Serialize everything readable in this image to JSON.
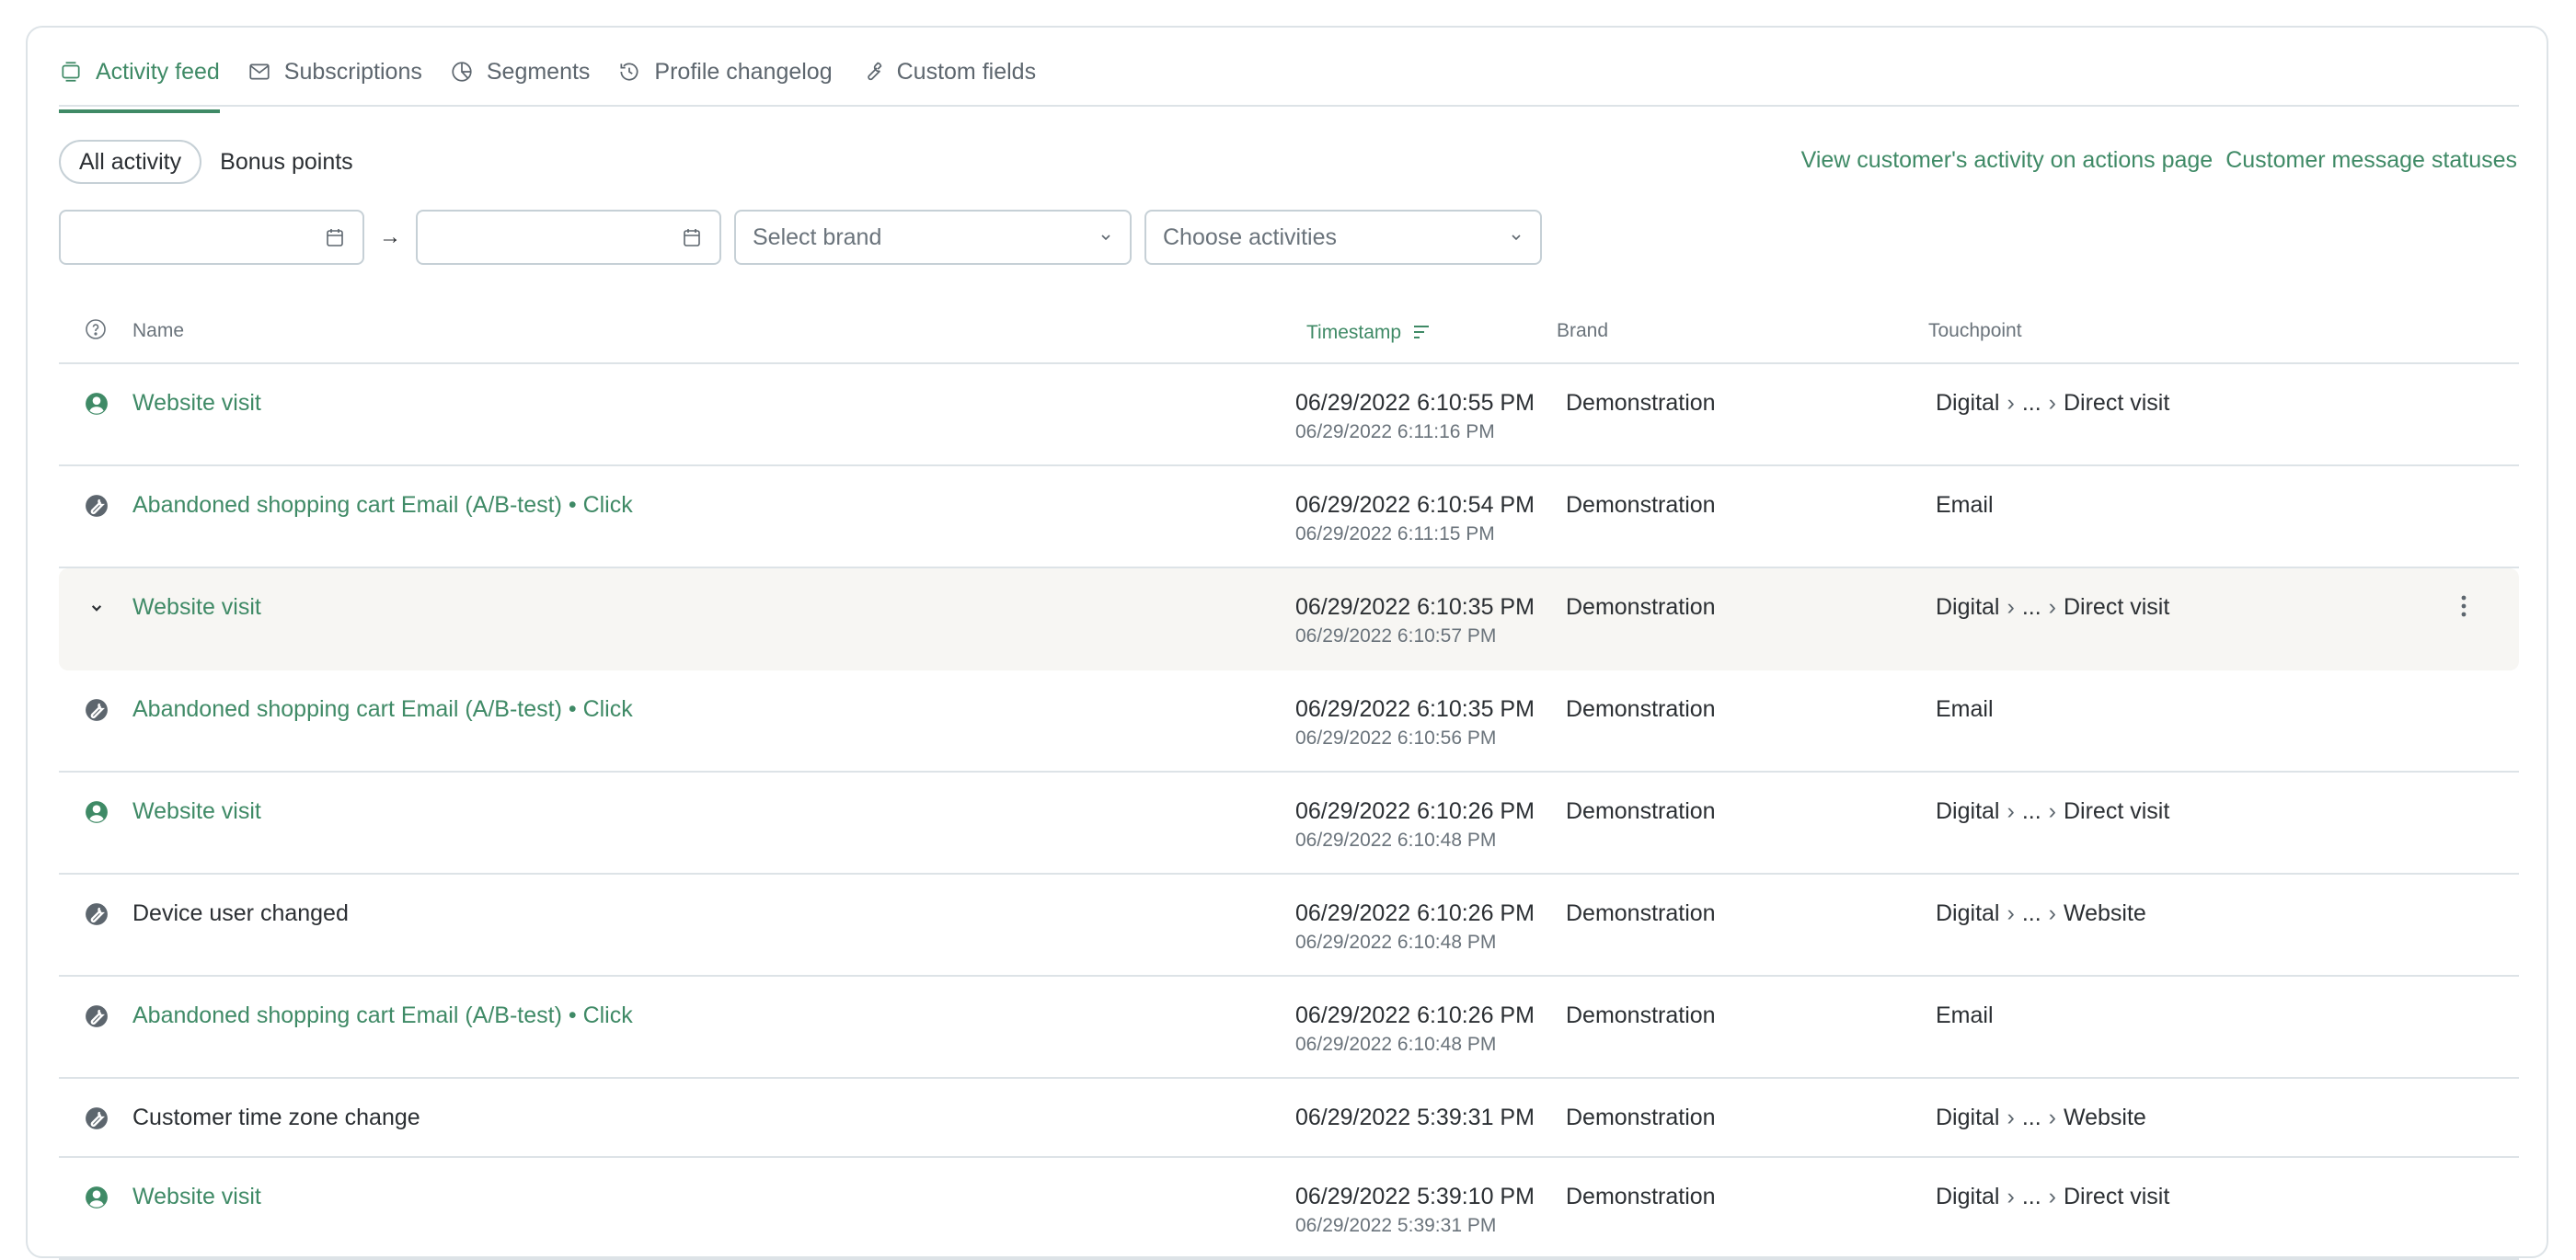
{
  "tabs": [
    {
      "label": "Activity feed",
      "icon": "activity-feed-icon",
      "active": true
    },
    {
      "label": "Subscriptions",
      "icon": "envelope-icon",
      "active": false
    },
    {
      "label": "Segments",
      "icon": "pie-chart-icon",
      "active": false
    },
    {
      "label": "Profile changelog",
      "icon": "history-icon",
      "active": false
    },
    {
      "label": "Custom fields",
      "icon": "wrench-icon",
      "active": false
    }
  ],
  "pills": [
    {
      "label": "All activity",
      "active": true
    },
    {
      "label": "Bonus points",
      "active": false
    }
  ],
  "links": {
    "actions_page": "View customer's activity on actions page",
    "message_statuses": "Customer message statuses"
  },
  "filters": {
    "date_from": "",
    "date_to": "",
    "arrow": "→",
    "brand_placeholder": "Select brand",
    "activities_placeholder": "Choose activities"
  },
  "table": {
    "headers": {
      "name": "Name",
      "timestamp": "Timestamp",
      "brand": "Brand",
      "touchpoint": "Touchpoint"
    },
    "rows": [
      {
        "icon": "user-icon",
        "name": "Website visit",
        "link": true,
        "ts": "06/29/2022 6:10:55 PM",
        "ts2": "06/29/2022 6:11:16 PM",
        "brand": "Demonstration",
        "touchpoint": [
          "Digital",
          "...",
          "Direct visit"
        ]
      },
      {
        "icon": "wrench-circle-icon",
        "name": "Abandoned shopping cart Email (A/B-test) • Click",
        "link": true,
        "ts": "06/29/2022 6:10:54 PM",
        "ts2": "06/29/2022 6:11:15 PM",
        "brand": "Demonstration",
        "touchpoint": [
          "Email"
        ]
      },
      {
        "icon": "chevron-down-icon",
        "name": "Website visit",
        "link": true,
        "ts": "06/29/2022 6:10:35 PM",
        "ts2": "06/29/2022 6:10:57 PM",
        "brand": "Demonstration",
        "touchpoint": [
          "Digital",
          "...",
          "Direct visit"
        ],
        "highlighted": true
      },
      {
        "icon": "wrench-circle-icon",
        "name": "Abandoned shopping cart Email (A/B-test) • Click",
        "link": true,
        "ts": "06/29/2022 6:10:35 PM",
        "ts2": "06/29/2022 6:10:56 PM",
        "brand": "Demonstration",
        "touchpoint": [
          "Email"
        ]
      },
      {
        "icon": "user-icon",
        "name": "Website visit",
        "link": true,
        "ts": "06/29/2022 6:10:26 PM",
        "ts2": "06/29/2022 6:10:48 PM",
        "brand": "Demonstration",
        "touchpoint": [
          "Digital",
          "...",
          "Direct visit"
        ]
      },
      {
        "icon": "wrench-circle-icon",
        "name": "Device user changed",
        "link": false,
        "ts": "06/29/2022 6:10:26 PM",
        "ts2": "06/29/2022 6:10:48 PM",
        "brand": "Demonstration",
        "touchpoint": [
          "Digital",
          "...",
          "Website"
        ]
      },
      {
        "icon": "wrench-circle-icon",
        "name": "Abandoned shopping cart Email (A/B-test) • Click",
        "link": true,
        "ts": "06/29/2022 6:10:26 PM",
        "ts2": "06/29/2022 6:10:48 PM",
        "brand": "Demonstration",
        "touchpoint": [
          "Email"
        ]
      },
      {
        "icon": "wrench-circle-icon",
        "name": "Customer time zone change",
        "link": false,
        "ts": "06/29/2022 5:39:31 PM",
        "ts2": "",
        "brand": "Demonstration",
        "touchpoint": [
          "Digital",
          "...",
          "Website"
        ]
      },
      {
        "icon": "user-icon",
        "name": "Website visit",
        "link": true,
        "ts": "06/29/2022 5:39:10 PM",
        "ts2": "06/29/2022 5:39:31 PM",
        "brand": "Demonstration",
        "touchpoint": [
          "Digital",
          "...",
          "Direct visit"
        ]
      }
    ]
  },
  "colors": {
    "accent": "#3f8a66",
    "muted": "#6a737b",
    "border": "#dde3e7",
    "highlight_row": "#f7f6f3"
  }
}
